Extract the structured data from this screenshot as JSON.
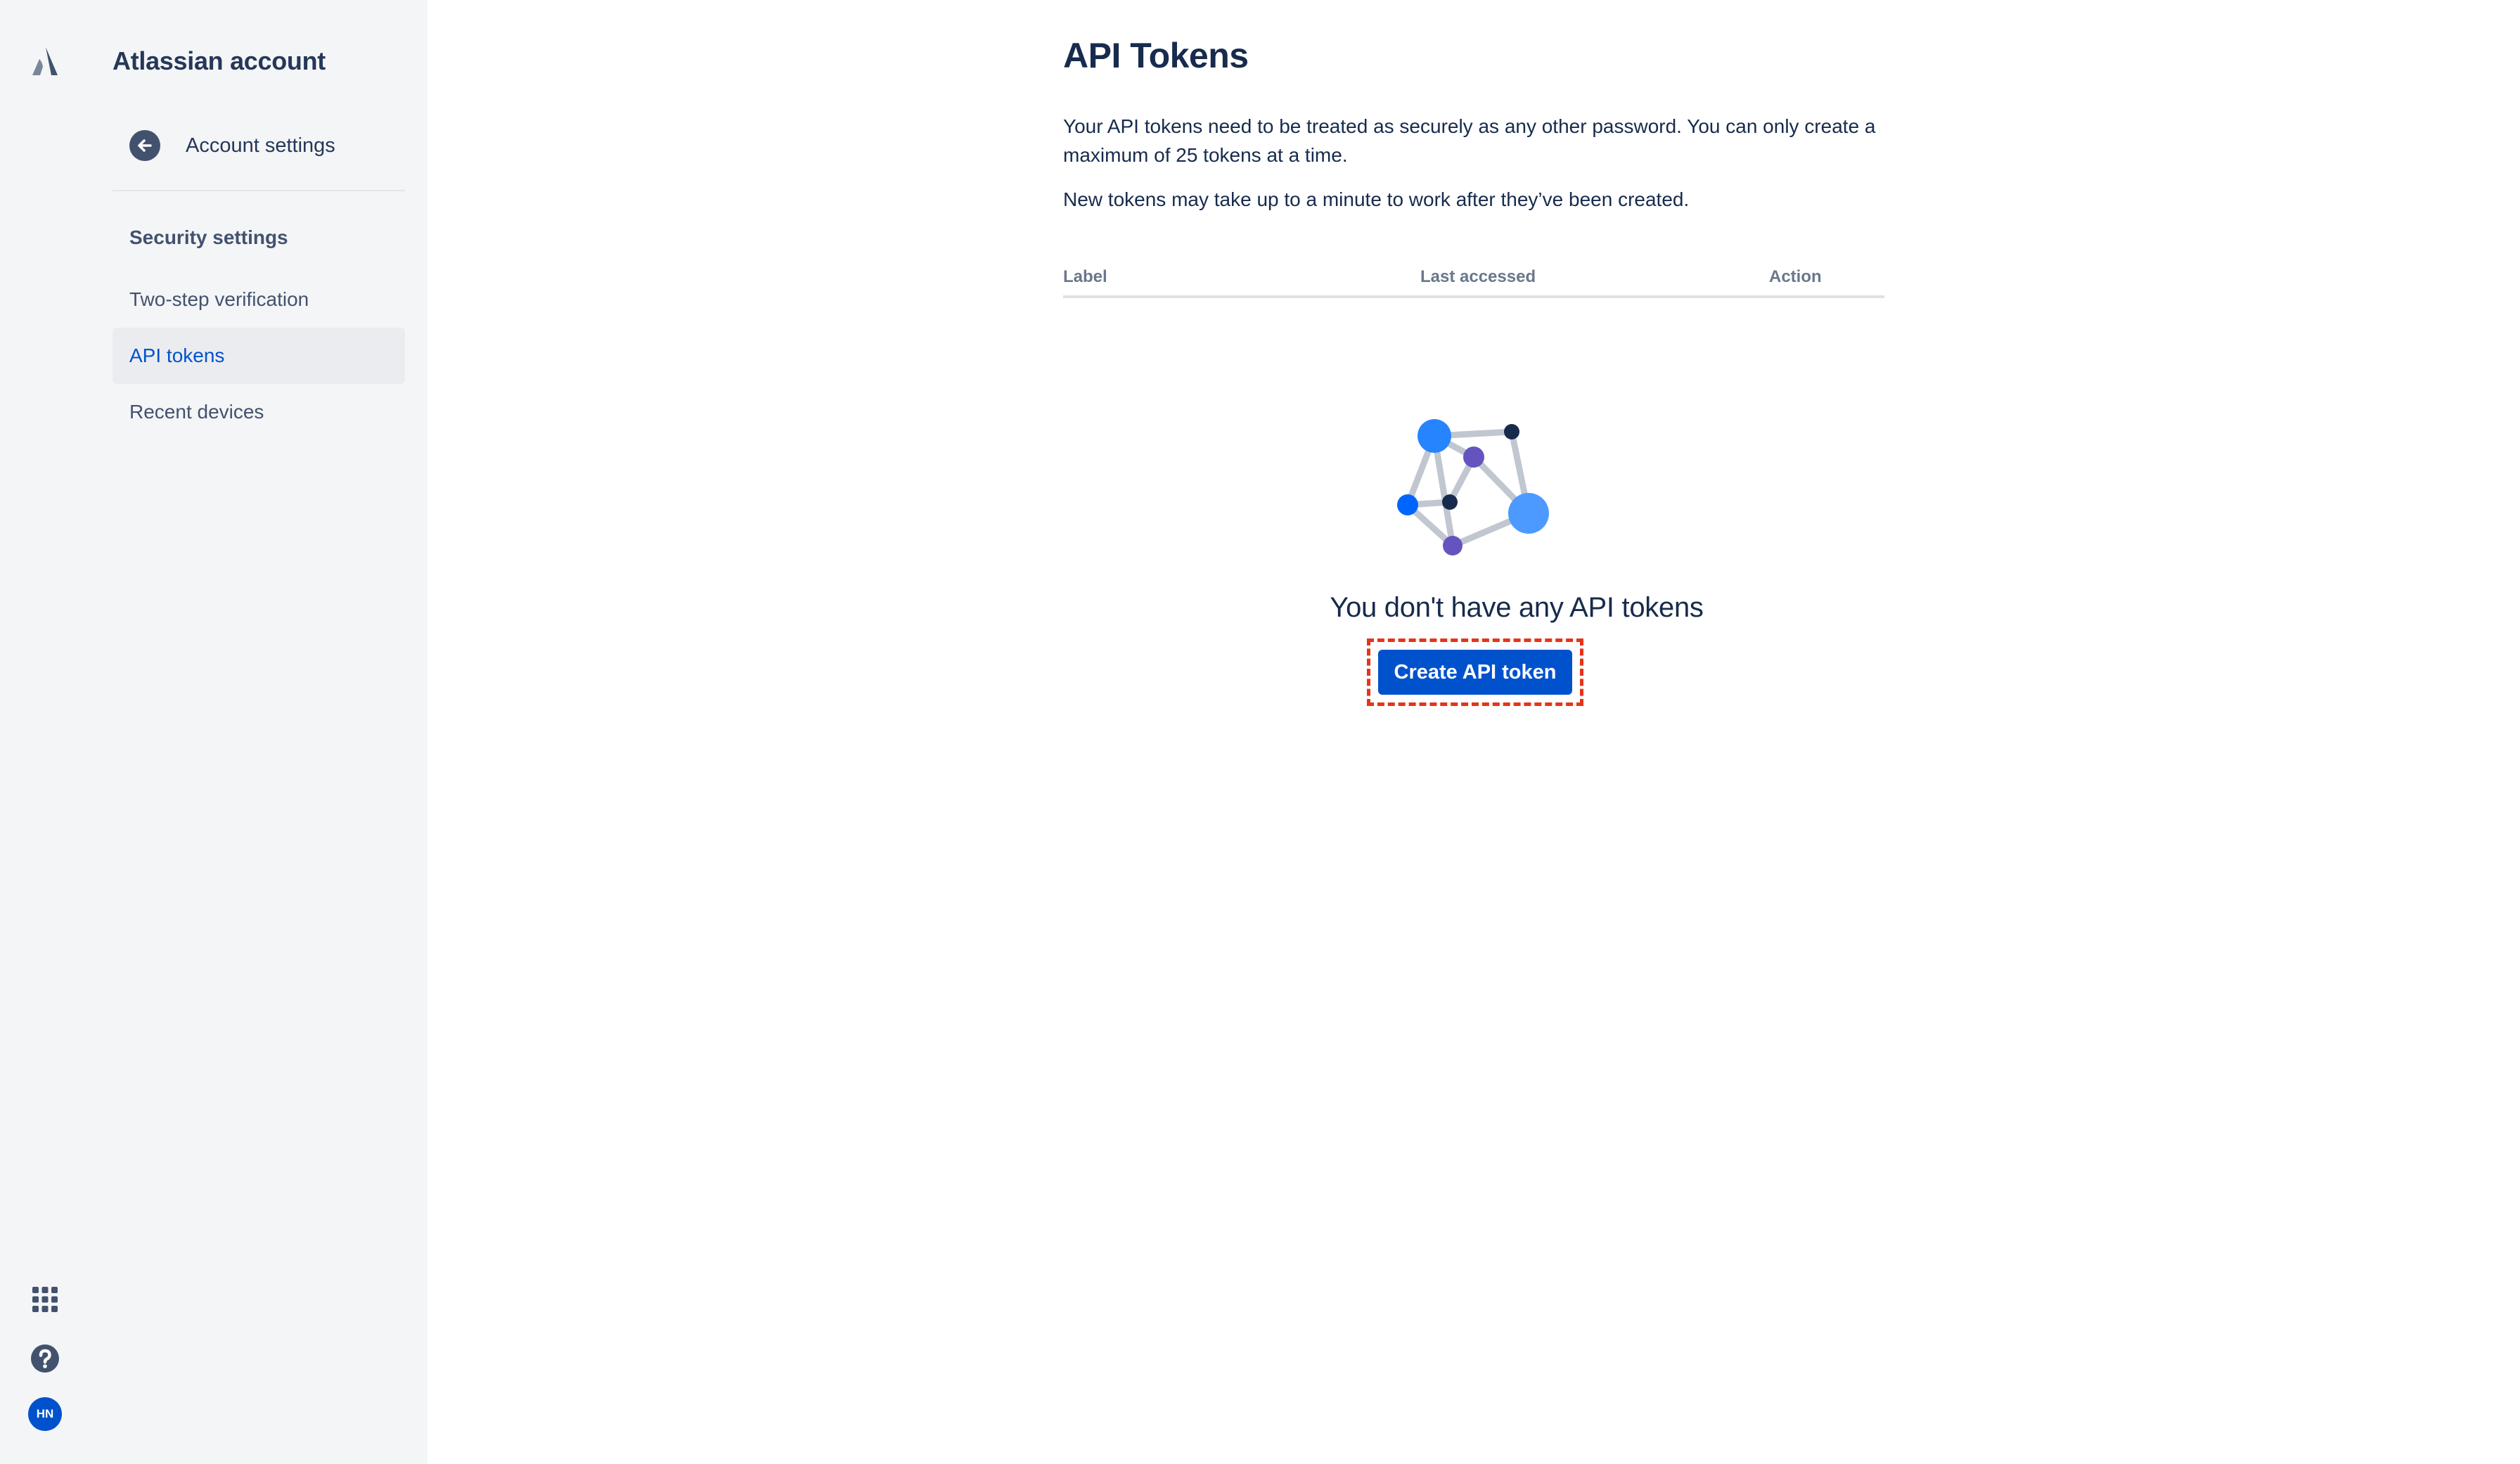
{
  "sidebar": {
    "product_title": "Atlassian account",
    "back_label": "Account settings",
    "section_heading": "Security settings",
    "items": [
      {
        "label": "Two-step verification"
      },
      {
        "label": "API tokens"
      },
      {
        "label": "Recent devices"
      }
    ],
    "active_item": "API tokens",
    "avatar_initials": "HN"
  },
  "main": {
    "title": "API Tokens",
    "description_1": "Your API tokens need to be treated as securely as any other password. You can only create a maximum of 25 tokens at a time.",
    "description_2": "New tokens may take up to a minute to work after they’ve been created.",
    "table": {
      "columns": [
        "Label",
        "Last accessed",
        "Action"
      ],
      "rows": []
    },
    "empty_state": {
      "title": "You don't have any API tokens",
      "button_label": "Create API token"
    }
  },
  "icons": {
    "logo": "atlassian-logo-icon",
    "back": "arrow-left-circle-icon",
    "apps": "app-switcher-grid-icon",
    "help": "help-question-icon"
  },
  "colors": {
    "brand_blue": "#0052CC",
    "sidebar_bg": "#F4F5F7",
    "active_bg": "#EBECF0",
    "highlight_dashed": "#E5341A"
  }
}
